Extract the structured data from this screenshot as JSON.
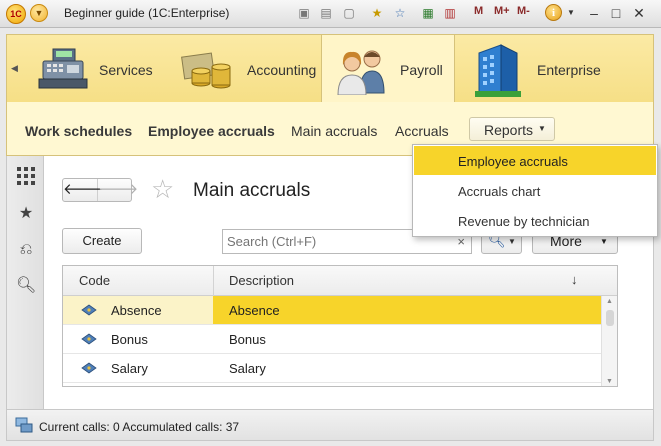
{
  "window": {
    "title": "Beginner guide  (1C:Enterprise)",
    "memory_buttons": [
      "M",
      "M+",
      "M-"
    ]
  },
  "sections": [
    {
      "label": "Services",
      "icon": "cash-register-icon"
    },
    {
      "label": "Accounting",
      "icon": "coins-icon"
    },
    {
      "label": "Payroll",
      "icon": "people-icon",
      "active": true
    },
    {
      "label": "Enterprise",
      "icon": "building-icon"
    }
  ],
  "subnav": {
    "items": [
      {
        "label": "Work schedules",
        "bold": true
      },
      {
        "label": "Employee accruals",
        "bold": true
      },
      {
        "label": "Main accruals",
        "bold": false
      },
      {
        "label": "Accruals",
        "bold": false
      }
    ],
    "reports_label": "Reports"
  },
  "dropdown": {
    "items": [
      "Employee accruals",
      "Accruals chart",
      "Revenue by technician"
    ],
    "highlighted_index": 0
  },
  "form": {
    "title": "Main accruals",
    "create_label": "Create",
    "search_placeholder": "Search (Ctrl+F)",
    "clear_glyph": "×",
    "more_label": "More",
    "columns": {
      "code": "Code",
      "description": "Description"
    },
    "rows": [
      {
        "code": "Absence",
        "description": "Absence",
        "selected": true
      },
      {
        "code": "Bonus",
        "description": "Bonus",
        "selected": false
      },
      {
        "code": "Salary",
        "description": "Salary",
        "selected": false
      }
    ]
  },
  "statusbar": {
    "text": "Current calls: 0   Accumulated calls: 37"
  },
  "colors": {
    "accent_yellow": "#f7d42a",
    "section_bg": "#f6df86",
    "subnav_bg": "#fff8d2"
  }
}
